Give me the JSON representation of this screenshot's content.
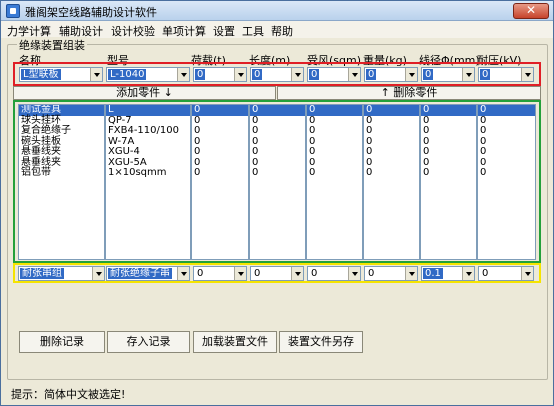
{
  "window": {
    "title": "雅阁架空线路辅助设计软件",
    "close_glyph": "✕"
  },
  "menu": [
    "力学计算",
    "辅助设计",
    "设计校验",
    "单项计算",
    "设置",
    "工具",
    "帮助"
  ],
  "group": {
    "label": "绝缘装置组装"
  },
  "columns": [
    "名称",
    "型号",
    "荷载(t)",
    "长度(m)",
    "受风(sqm)",
    "重量(kg)",
    "线径Φ(mm)",
    "耐压(kV)"
  ],
  "top_row": [
    "L型联板",
    "L-1040",
    "0",
    "0",
    "0",
    "0",
    "0",
    "0"
  ],
  "buttons": {
    "add_part": "添加零件 ↓",
    "delete_part": "↑ 删除零件"
  },
  "list_columns": [
    [
      "测试金具",
      "球头挂环",
      "复合绝缘子",
      "碗头挂板",
      "悬垂线夹",
      "悬垂线夹",
      "铝包带"
    ],
    [
      "L",
      "QP-7",
      "FXB4-110/100",
      "W-7A",
      "XGU-4",
      "XGU-5A",
      "1×10sqmm"
    ],
    [
      "0",
      "0",
      "0",
      "0",
      "0",
      "0",
      "0"
    ],
    [
      "0",
      "0",
      "0",
      "0",
      "0",
      "0",
      "0"
    ],
    [
      "0",
      "0",
      "0",
      "0",
      "0",
      "0",
      "0"
    ],
    [
      "0",
      "0",
      "0",
      "0",
      "0",
      "0",
      "0"
    ],
    [
      "0",
      "0",
      "0",
      "0",
      "0",
      "0",
      "0"
    ],
    [
      "0",
      "0",
      "0",
      "0",
      "0",
      "0",
      "0"
    ]
  ],
  "bottom_row": [
    "耐张串组",
    "耐张绝缘子串",
    "0",
    "0",
    "0",
    "0",
    "0.1",
    "0"
  ],
  "actions": [
    "删除记录",
    "存入记录",
    "加载装置文件",
    "装置文件另存"
  ],
  "status": {
    "text": "提示：简体中文被选定!"
  },
  "colors": {
    "red_frame": "#e01f26",
    "green_frame": "#23a03a",
    "yellow_frame": "#f5e400",
    "selection": "#316ac5"
  }
}
